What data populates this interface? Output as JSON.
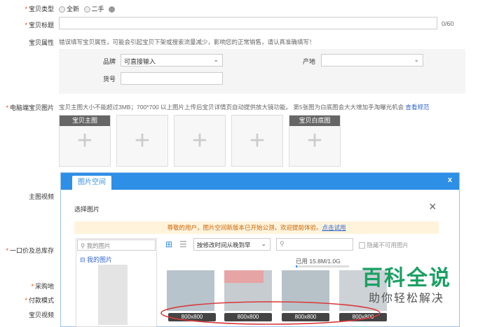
{
  "form": {
    "type_label": "宝贝类型",
    "type_opt1": "全新",
    "type_opt2": "二手",
    "title_label": "宝贝标题",
    "title_count": "0/60",
    "attr_label": "宝贝属性",
    "attr_hint": "错误填写宝贝属性，可能会引起宝贝下架或搜索流量减少，影响您的正常销售，请认真准确填写！",
    "brand_label": "品牌",
    "brand_value": "可直接输入",
    "origin_label": "产地",
    "sku_label": "货号",
    "pc_img_label": "电脑端宝贝图片",
    "pc_img_hint": "宝贝主图大小不能超过3MB；700*700 以上图片上传后宝贝详情页自动提供放大镜功能。 第5张图为白底图会大大增加手淘曝光机会",
    "pc_img_link": "查看规范",
    "slot1_caption": "宝贝主图",
    "slot5_caption": "宝贝白底图",
    "video_label": "主图视频",
    "price_label": "一口价及总库存",
    "purchase_label": "采购地",
    "payment_label": "付款模式",
    "bb_video_label": "宝贝视频"
  },
  "dialog": {
    "tab": "图片空间",
    "close": "x",
    "subtitle": "选择图片",
    "notice": "尊敬的用户，图片空间新版本已开始公测，欢迎提前体验。",
    "notice_link": "点击试用",
    "search_placeholder": "我的图片",
    "tree_root": "我的图片",
    "sort_value": "按修改时间从晚到早",
    "hide_unusable": "隐藏不可用图片",
    "used_text": "已用 15.8M/1.0G",
    "thumb_labels": [
      "800x800",
      "800x800",
      "800x800",
      "800x800"
    ]
  },
  "watermark": {
    "title": "百科全说",
    "subtitle": "助你轻松解决"
  }
}
